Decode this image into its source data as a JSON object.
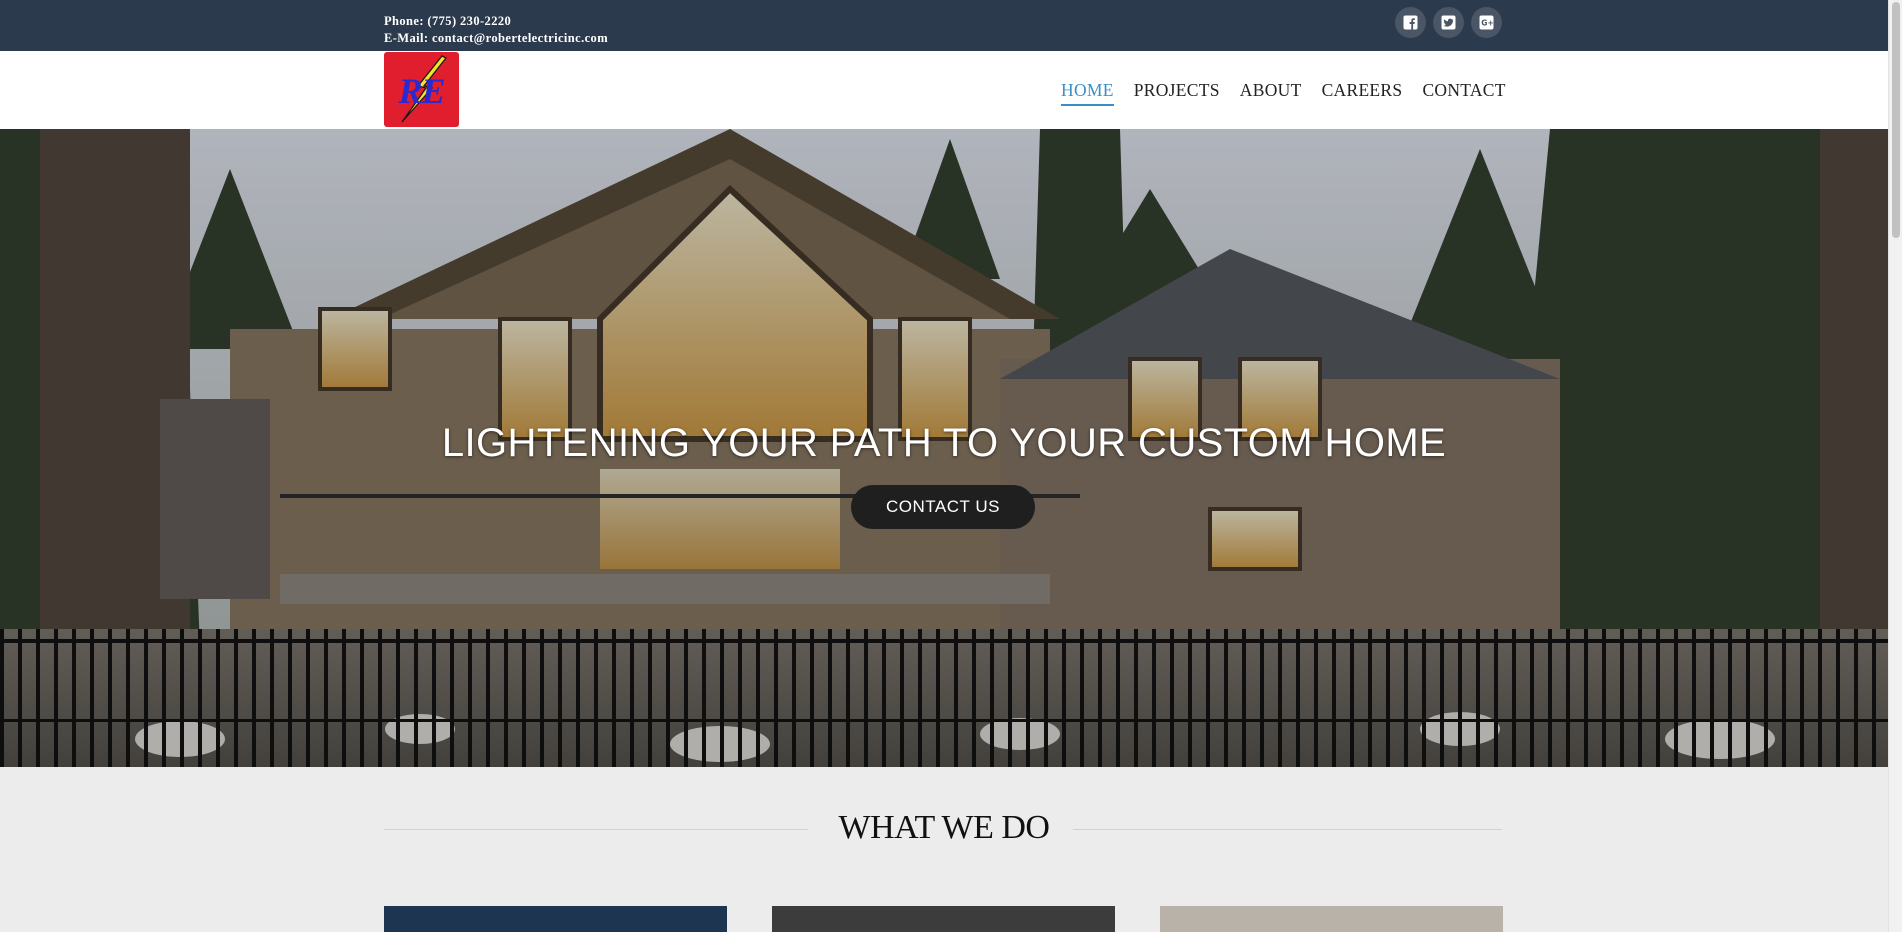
{
  "topbar": {
    "phone": "Phone: (775) 230-2220",
    "email": "E-Mail: contact@robertelectricinc.com",
    "social": [
      "facebook-icon",
      "twitter-icon",
      "google-plus-icon"
    ]
  },
  "logo": {
    "text": "RE"
  },
  "nav": {
    "items": [
      "HOME",
      "PROJECTS",
      "ABOUT",
      "CAREERS",
      "CONTACT"
    ],
    "active": "HOME"
  },
  "hero": {
    "headline": "LIGHTENING YOUR PATH TO YOUR CUSTOM HOME",
    "cta": "CONTACT US"
  },
  "section": {
    "title": "WHAT WE DO"
  },
  "colors": {
    "topbar": "#2b3a4d",
    "accent": "#3a8fc8",
    "logo_bg": "#e01e2e"
  }
}
